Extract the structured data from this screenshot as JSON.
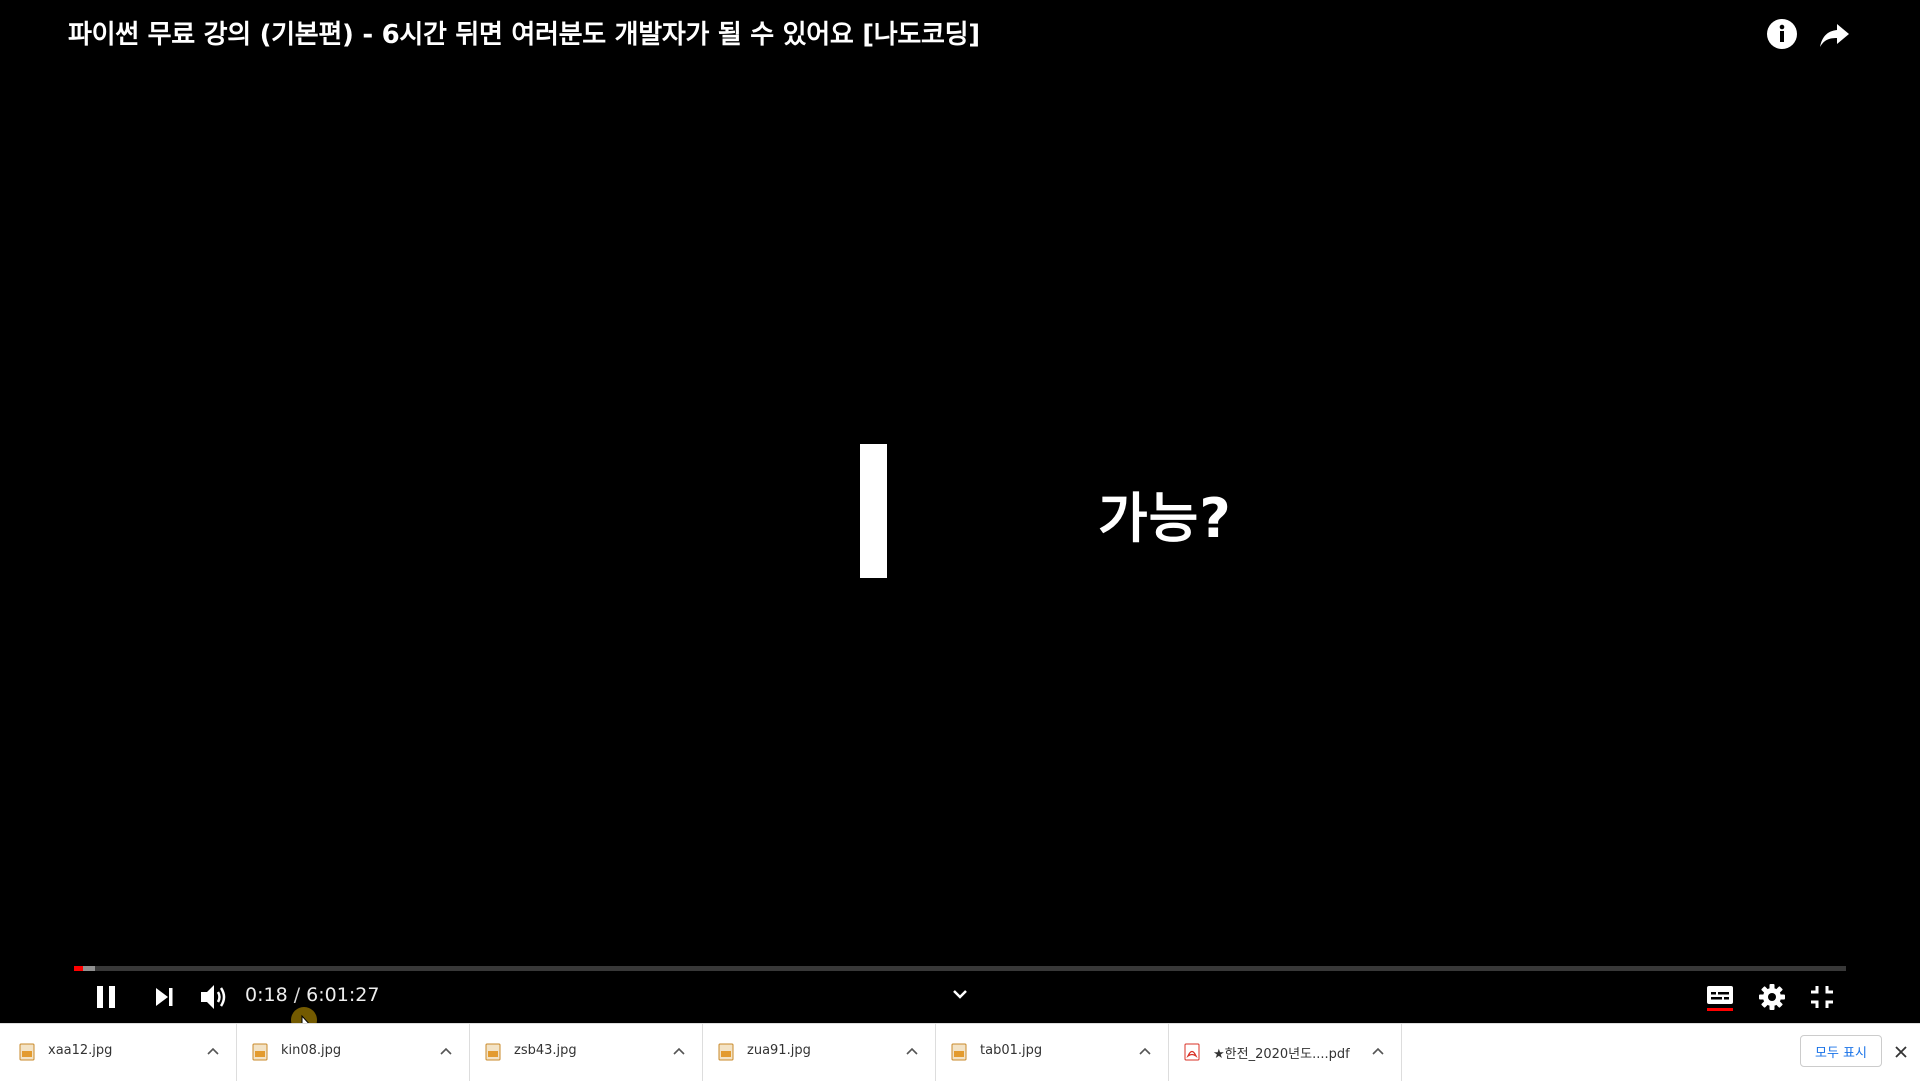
{
  "video": {
    "title": "파이썬 무료 강의 (기본편) - 6시간 뒤면 여러분도 개발자가 될 수 있어요 [나도코딩]",
    "frame_text": "가능?",
    "current_time": "0:18",
    "separator": " / ",
    "duration": "6:01:27",
    "progress_played": 0.005,
    "progress_loaded": 0.012,
    "accent_color": "#ff0000"
  },
  "top_icons": [
    "info-icon",
    "share-icon"
  ],
  "controls": [
    "pause-icon",
    "next-icon",
    "volume-icon",
    "chevron-down-icon",
    "subtitles-icon",
    "settings-icon",
    "exit-fullscreen-icon"
  ],
  "downloads": {
    "items": [
      {
        "name": "xaa12.jpg",
        "icon": "image-file-icon"
      },
      {
        "name": "kin08.jpg",
        "icon": "image-file-icon"
      },
      {
        "name": "zsb43.jpg",
        "icon": "image-file-icon"
      },
      {
        "name": "zua91.jpg",
        "icon": "image-file-icon"
      },
      {
        "name": "tab01.jpg",
        "icon": "image-file-icon"
      },
      {
        "name": "★한전_2020년도....pdf",
        "icon": "pdf-file-icon"
      }
    ],
    "show_all_label": "모두 표시"
  }
}
